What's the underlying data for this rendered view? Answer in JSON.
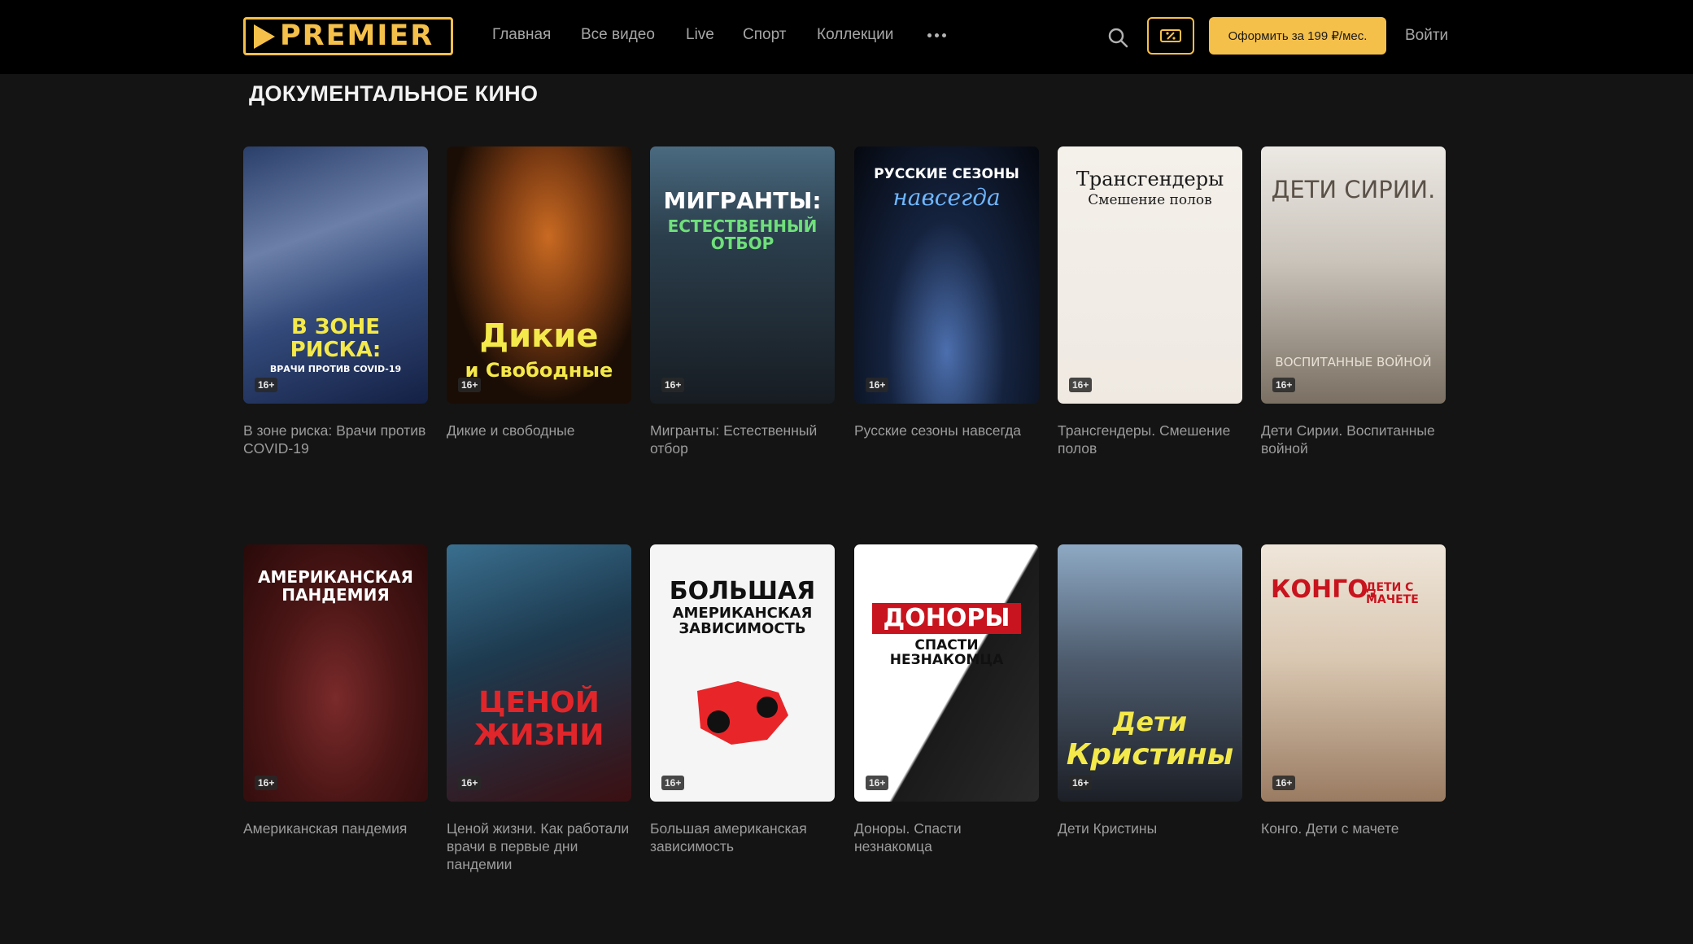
{
  "header": {
    "logo": "PREMIER",
    "nav": [
      "Главная",
      "Все видео",
      "Live",
      "Спорт",
      "Коллекции"
    ],
    "subscribe_label": "Оформить за 199 ₽/мес.",
    "login_label": "Войти",
    "icons": {
      "search": "search-icon",
      "more": "more-dots-icon",
      "promo": "promo-ticket-icon"
    },
    "accent": "#f5c04a"
  },
  "section": {
    "title": "ДОКУМЕНТАЛЬНОЕ КИНО"
  },
  "items": [
    {
      "title": "В зоне риска: Врачи против COVID-19",
      "age": "16+",
      "poster_text": "В ЗОНЕ РИСКА:",
      "poster_sub": "ВРАЧИ ПРОТИВ COVID-19"
    },
    {
      "title": "Дикие и свободные",
      "age": "16+",
      "poster_text": "Дикие",
      "poster_sub": "и Свободные"
    },
    {
      "title": "Мигранты: Естественный отбор",
      "age": "16+",
      "poster_text": "МИГРАНТЫ:",
      "poster_sub": "ЕСТЕСТВЕННЫЙ ОТБОР"
    },
    {
      "title": "Русские сезоны навсегда",
      "age": "16+",
      "poster_text": "РУССКИЕ СЕЗОНЫ",
      "poster_sub": "навсегда"
    },
    {
      "title": "Трансгендеры. Смешение полов",
      "age": "16+",
      "poster_text": "Трансгендеры",
      "poster_sub": "Смешение полов"
    },
    {
      "title": "Дети Сирии. Воспитанные войной",
      "age": "16+",
      "poster_text": "ДЕТИ СИРИИ.",
      "poster_sub": "ВОСПИТАННЫЕ ВОЙНОЙ"
    },
    {
      "title": "Американская пандемия",
      "age": "16+",
      "poster_text": "АМЕРИКАНСКАЯ",
      "poster_sub": "ПАНДЕМИЯ"
    },
    {
      "title": "Ценой жизни. Как работали врачи в первые дни пандемии",
      "age": "16+",
      "poster_text": "ЦЕНОЙ",
      "poster_sub": "ЖИЗНИ"
    },
    {
      "title": "Большая американская зависимость",
      "age": "16+",
      "poster_text": "БОЛЬШАЯ",
      "poster_sub": "АМЕРИКАНСКАЯ ЗАВИСИМОСТЬ"
    },
    {
      "title": "Доноры. Спасти незнакомца",
      "age": "16+",
      "poster_text": "ДОНОРЫ",
      "poster_sub": "СПАСТИ НЕЗНАКОМЦА"
    },
    {
      "title": "Дети Кристины",
      "age": "16+",
      "poster_text": "Дети",
      "poster_sub": "Кристины"
    },
    {
      "title": "Конго. Дети с мачете",
      "age": "16+",
      "poster_text": "КОНГО.",
      "poster_sub": "ДЕТИ С МАЧЕТЕ"
    }
  ]
}
